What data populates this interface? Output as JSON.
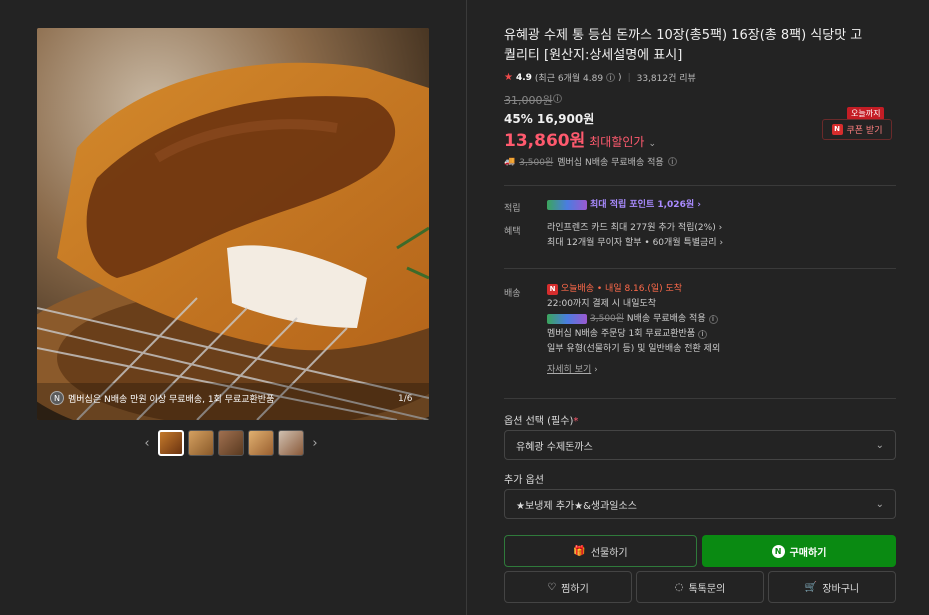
{
  "product": {
    "title": "유혜광 수제 통 등심 돈까스 10장(총5팩) 16장(총 8팩) 식당맛 고퀄리티 [원산지:상세설명에 표시]",
    "rating": "4.9",
    "rating_sub": "(최근 6개월 4.89",
    "rating_close": ")",
    "reviews": "33,812건 리뷰",
    "original_price": "31,000원",
    "discount_line": "45% 16,900원",
    "best_price": "13,860원",
    "best_label": "최대할인가",
    "ship_strike": "3,500원",
    "ship_text": "멤버십 N배송 무료배송 적용"
  },
  "coupon": {
    "tag": "오늘까지",
    "label": "쿠폰 받기"
  },
  "image": {
    "caption": "멤버십은 N배송 만원 이상 무료배송, 1회 무료교환반품",
    "counter": "1/6"
  },
  "benefits": {
    "points_label": "적립",
    "points_text": "최대 적립 포인트 1,026원",
    "benefit_label": "혜택",
    "benefit_line1": "라인프렌즈 카드 최대 277원 추가 적립(2%)",
    "benefit_line2": "최대 12개월 무이자 할부 • 60개월 특별금리"
  },
  "delivery": {
    "label": "배송",
    "tag": "오늘배송",
    "arrival": "• 내일 8.16.(일) 도착",
    "cutoff": "22:00까지 결제 시 내일도착",
    "strike": "3,500원",
    "free": "N배송 무료배송 적용",
    "exchange": "멤버십 N배송 주문당 1회 무료교환반품",
    "excluded": "일부 유형(선물하기 등) 및 일반배송 전환 제외",
    "more": "자세히 보기"
  },
  "options": {
    "required_label": "옵션 선택 (필수)",
    "required_value": "유혜광 수제돈까스",
    "extra_label": "추가 옵션",
    "extra_value": "★보냉제 추가★&생과일소스"
  },
  "buttons": {
    "gift": "선물하기",
    "buy": "구매하기",
    "wish": "찜하기",
    "talk": "톡톡문의",
    "cart": "장바구니"
  },
  "colors": {
    "accent_red": "#ff5a6e",
    "buy_green": "#0a8a12",
    "points_purple": "#a98bff"
  }
}
